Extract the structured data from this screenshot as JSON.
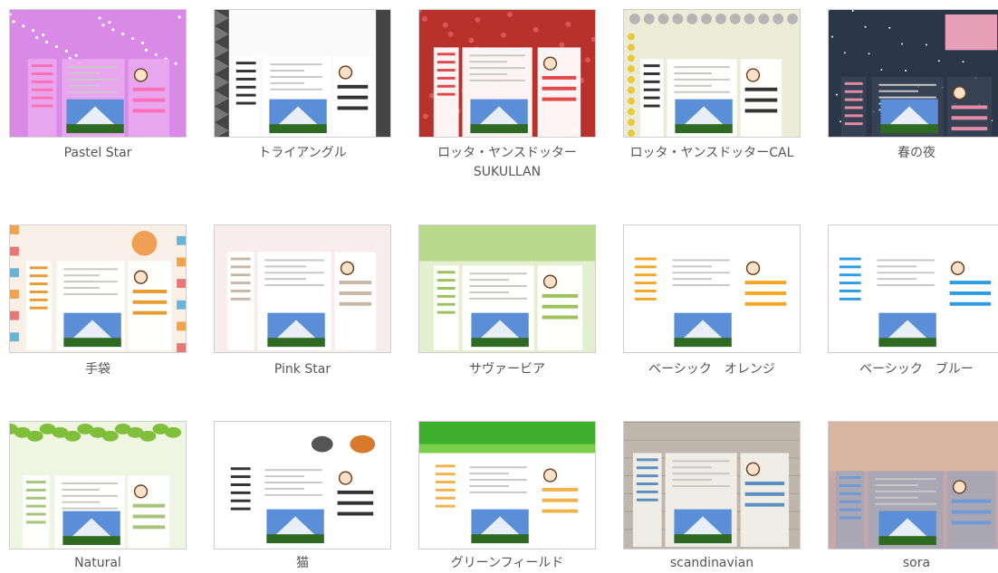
{
  "themes": [
    {
      "name": "Pastel Star",
      "bg": "#d98ae6",
      "style": "pastel"
    },
    {
      "name": "トライアングル",
      "bg": "#3a3a3a",
      "style": "triangle"
    },
    {
      "name": "ロッタ・ヤンスドッター SUKULLAN",
      "bg": "#b8322b",
      "style": "red"
    },
    {
      "name": "ロッタ・ヤンスドッターCAL",
      "bg": "#e9e5cc",
      "style": "cal"
    },
    {
      "name": "春の夜",
      "bg": "#2a3646",
      "style": "night"
    },
    {
      "name": "手袋",
      "bg": "#f6efe4",
      "style": "mitten"
    },
    {
      "name": "Pink Star",
      "bg": "#f7e9ea",
      "style": "pink"
    },
    {
      "name": "サヴァービア",
      "bg": "#dfeec9",
      "style": "suburbia"
    },
    {
      "name": "ベーシック　オレンジ",
      "bg": "#ffffff",
      "style": "orange"
    },
    {
      "name": "ベーシック　ブルー",
      "bg": "#ffffff",
      "style": "blue"
    },
    {
      "name": "Natural",
      "bg": "#e8f2d8",
      "style": "natural"
    },
    {
      "name": "猫",
      "bg": "#ffffff",
      "style": "cat"
    },
    {
      "name": "グリーンフィールド",
      "bg": "#ffffff",
      "style": "green"
    },
    {
      "name": "scandinavian",
      "bg": "#b9b2a8",
      "style": "scandi"
    },
    {
      "name": "sora",
      "bg": "#c9a9a8",
      "style": "sora"
    }
  ]
}
